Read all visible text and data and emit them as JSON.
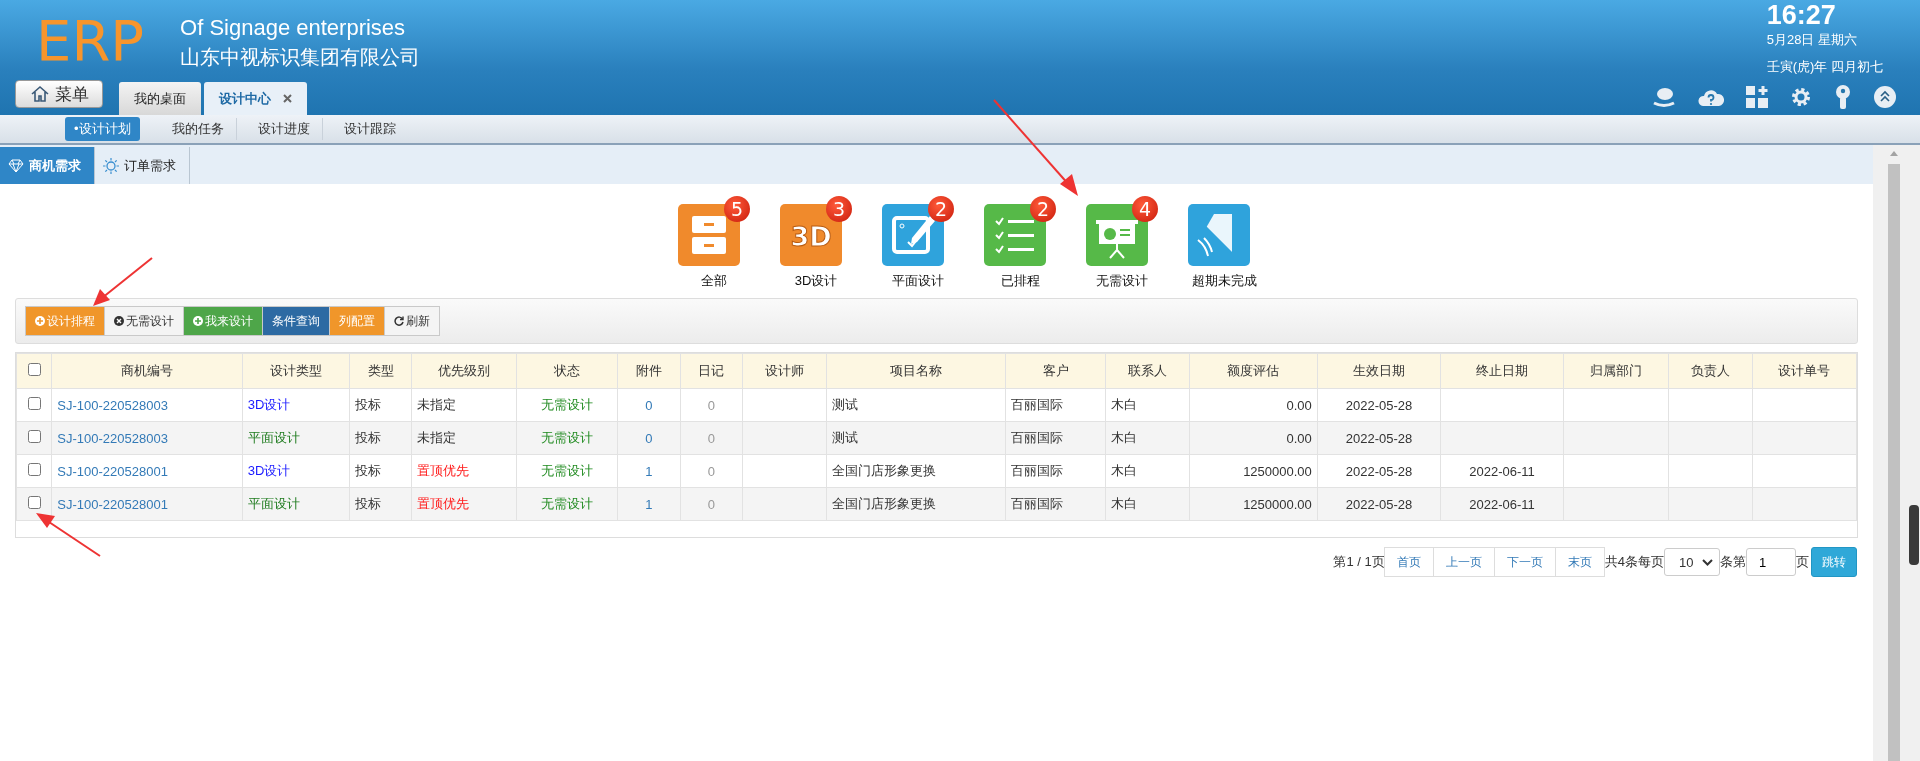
{
  "header": {
    "logo": "ERP",
    "subtitle_en": "Of Signage enterprises",
    "subtitle_cn": "山东中视标识集团有限公司",
    "menu_button": "菜单",
    "tabs": [
      {
        "label": "我的桌面",
        "selected": false,
        "closable": false
      },
      {
        "label": "设计中心",
        "selected": true,
        "closable": true
      }
    ],
    "clock": {
      "time": "16:27",
      "date": "5月28日 星期六",
      "lunar": "壬寅(虎)年 四月初七"
    }
  },
  "subnav": [
    {
      "label": "•设计计划",
      "selected": true
    },
    {
      "label": "我的任务",
      "selected": false
    },
    {
      "label": "设计进度",
      "selected": false
    },
    {
      "label": "设计跟踪",
      "selected": false
    }
  ],
  "subtabs": [
    {
      "label": "商机需求",
      "selected": true,
      "kind": "diamond"
    },
    {
      "label": "订单需求",
      "selected": false,
      "kind": "sun"
    }
  ],
  "categories": [
    {
      "label": "全部",
      "badge": "5",
      "color": "#f08a2c",
      "kind": "drawer"
    },
    {
      "label": "3D设计",
      "badge": "3",
      "color": "#f08a2c",
      "kind": "threed",
      "icon_text": "3D"
    },
    {
      "label": "平面设计",
      "badge": "2",
      "color": "#2fa3dc",
      "kind": "edit"
    },
    {
      "label": "已排程",
      "badge": "2",
      "color": "#56b948",
      "kind": "list"
    },
    {
      "label": "无需设计",
      "badge": "4",
      "color": "#56b948",
      "kind": "board"
    },
    {
      "label": "超期未完成",
      "color": "#2fa3dc",
      "kind": "bell"
    }
  ],
  "toolbar": [
    {
      "label": "设计排程",
      "color": "#f0962a",
      "kind": "plus"
    },
    {
      "label": "无需设计",
      "color": "#f4f4f4",
      "kind": "cross"
    },
    {
      "label": "我来设计",
      "color": "#4ea649",
      "kind": "plus"
    },
    {
      "label": "条件查询",
      "color": "#2d6aa3"
    },
    {
      "label": "列配置",
      "color": "#f0962a"
    },
    {
      "label": "刷新",
      "color": "#f4f4f4",
      "kind": "refresh"
    }
  ],
  "table": {
    "all_checked": false,
    "columns": [
      "商机编号",
      "设计类型",
      "类型",
      "优先级别",
      "状态",
      "附件",
      "日记",
      "设计师",
      "项目名称",
      "客户",
      "联系人",
      "额度评估",
      "生效日期",
      "终止日期",
      "归属部门",
      "负责人",
      "设计单号"
    ],
    "rows": [
      {
        "checked": false,
        "code": "SJ-100-220528003",
        "design_type": {
          "text": "3D设计",
          "color": "#1a1aff"
        },
        "type": "投标",
        "priority": {
          "text": "未指定",
          "color": "#333333"
        },
        "status": "无需设计",
        "attachments": "0",
        "diary": "0",
        "project": "测试",
        "customer": "百丽国际",
        "contact": "木白",
        "amount": "0.00",
        "effective_date": "2022-05-28"
      },
      {
        "checked": false,
        "code": "SJ-100-220528003",
        "design_type": {
          "text": "平面设计",
          "color": "#1e7b1e"
        },
        "type": "投标",
        "priority": {
          "text": "未指定",
          "color": "#333333"
        },
        "status": "无需设计",
        "attachments": "0",
        "diary": "0",
        "project": "测试",
        "customer": "百丽国际",
        "contact": "木白",
        "amount": "0.00",
        "effective_date": "2022-05-28"
      },
      {
        "checked": false,
        "code": "SJ-100-220528001",
        "design_type": {
          "text": "3D设计",
          "color": "#1a1aff"
        },
        "type": "投标",
        "priority": {
          "text": "置顶优先",
          "color": "#ff1a1a"
        },
        "status": "无需设计",
        "attachments": "1",
        "diary": "0",
        "project": "全国门店形象更换",
        "customer": "百丽国际",
        "contact": "木白",
        "amount": "1250000.00",
        "effective_date": "2022-05-28",
        "end_date": "2022-06-11"
      },
      {
        "checked": false,
        "code": "SJ-100-220528001",
        "design_type": {
          "text": "平面设计",
          "color": "#1e7b1e"
        },
        "type": "投标",
        "priority": {
          "text": "置顶优先",
          "color": "#ff1a1a"
        },
        "status": "无需设计",
        "attachments": "1",
        "diary": "0",
        "project": "全国门店形象更换",
        "customer": "百丽国际",
        "contact": "木白",
        "amount": "1250000.00",
        "effective_date": "2022-05-28",
        "end_date": "2022-06-11"
      }
    ]
  },
  "pagination": {
    "page_info": "第1 / 1页",
    "buttons": [
      "首页",
      "上一页",
      "下一页",
      "末页"
    ],
    "total_text": "共4条每页",
    "page_size": "10",
    "rows_text": "条第",
    "page_input": "1",
    "page_suffix": "页",
    "go_button": "跳转"
  }
}
